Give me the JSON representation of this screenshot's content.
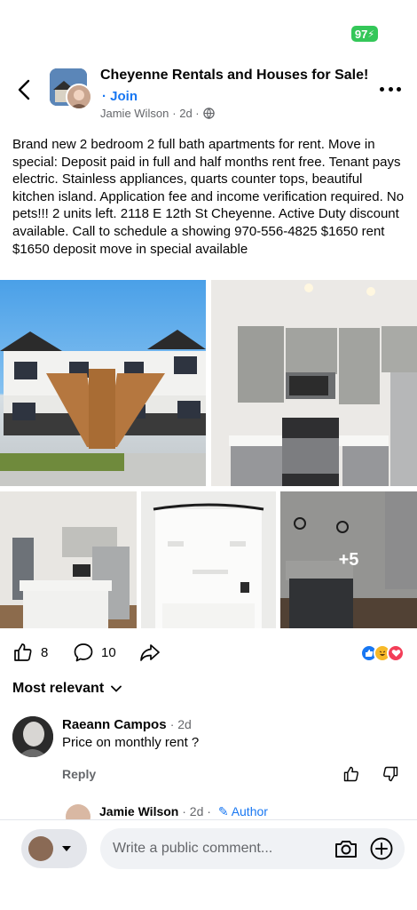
{
  "status": {
    "battery": "97"
  },
  "header": {
    "group_name": "Cheyenne Rentals and Houses for Sale!",
    "join": "· Join",
    "author": "Jamie Wilson",
    "time": "· 2d ·"
  },
  "post": {
    "text": "Brand new 2 bedroom 2 full bath apartments for rent. Move in special: Deposit paid in full and half months rent free. Tenant pays electric. Stainless appliances, quarts counter tops, beautiful kitchen island. Application fee and income verification required. No pets!!! 2 units left. 2118 E 12th St Cheyenne. Active Duty discount available. Call to schedule a showing 970-556-4825 $1650 rent $1650 deposit move in special available",
    "more_photos": "+5"
  },
  "stats": {
    "likes": "8",
    "comments": "10"
  },
  "sort": {
    "label": "Most relevant"
  },
  "comments": [
    {
      "name": "Raeann Campos",
      "time": "· 2d",
      "text": "Price on monthly rent ?",
      "reply": "Reply"
    }
  ],
  "reply_preview": {
    "name": "Jamie Wilson",
    "time": "· 2d ·",
    "badge": "Author"
  },
  "composer": {
    "placeholder": "Write a public comment..."
  },
  "colors": {
    "accent": "#1877f2",
    "battery": "#34c759"
  }
}
